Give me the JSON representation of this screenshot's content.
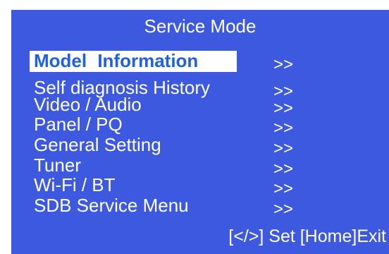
{
  "title": "Service Mode",
  "menu": {
    "items": [
      {
        "label": "Model  Information",
        "arrow": ">>"
      },
      {
        "label": "Self diagnosis History",
        "arrow": ">>"
      },
      {
        "label": "Video / Audio",
        "arrow": ">>"
      },
      {
        "label": "Panel / PQ",
        "arrow": ">>"
      },
      {
        "label": "General Setting",
        "arrow": ">>"
      },
      {
        "label": "Tuner",
        "arrow": ">>"
      },
      {
        "label": "Wi-Fi / BT",
        "arrow": ">>"
      },
      {
        "label": "SDB Service Menu",
        "arrow": ">>"
      }
    ],
    "selected_index": 0
  },
  "footer": {
    "hint": "[</>] Set [Home]Exit"
  },
  "colors": {
    "background": "#3d59e0",
    "text": "#ffffff",
    "highlight_bg": "#ffffff",
    "highlight_text": "#1f60e8"
  }
}
